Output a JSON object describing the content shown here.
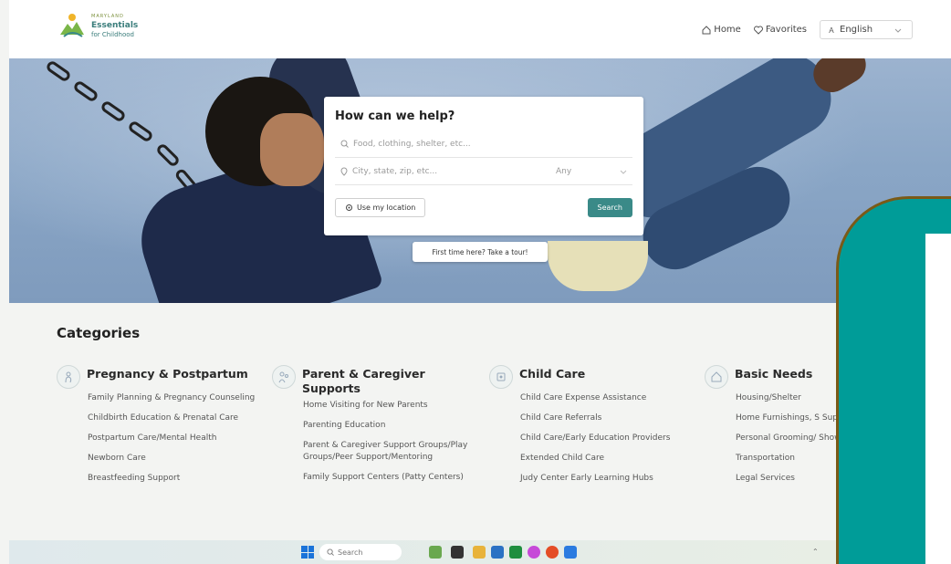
{
  "header": {
    "logo": {
      "line1": "MARYLAND",
      "line2": "Essentials",
      "line3": "for Childhood"
    },
    "nav": {
      "home": "Home",
      "favorites": "Favorites",
      "language": "English"
    }
  },
  "search": {
    "title": "How can we help?",
    "query_placeholder": "Food, clothing, shelter, etc...",
    "location_placeholder": "City, state, zip, etc...",
    "radius_value": "Any",
    "use_location_label": "Use my location",
    "search_label": "Search",
    "tour_label": "First time here? Take a tour!"
  },
  "categories": {
    "title": "Categories",
    "groups": [
      {
        "title": "Pregnancy & Postpartum",
        "links": [
          "Family Planning & Pregnancy Counseling",
          "Childbirth Education & Prenatal Care",
          "Postpartum Care/Mental Health",
          "Newborn Care",
          "Breastfeeding Support"
        ]
      },
      {
        "title": "Parent & Caregiver Supports",
        "links": [
          "Home Visiting for New Parents",
          "Parenting Education",
          "Parent & Caregiver Support Groups/Play Groups/Peer Support/Mentoring",
          "Family Support Centers (Patty Centers)"
        ]
      },
      {
        "title": "Child Care",
        "links": [
          "Child Care Expense Assistance",
          "Child Care Referrals",
          "Child Care/Early Education Providers",
          "Extended Child Care",
          "Judy Center Early Learning Hubs"
        ]
      },
      {
        "title": "Basic Needs",
        "links": [
          "Housing/Shelter",
          "Home Furnishings, S Supplies",
          "Personal Grooming/ Showers/Baths",
          "Transportation",
          "Legal Services"
        ]
      }
    ]
  },
  "taskbar": {
    "search_placeholder": "Search"
  },
  "colors": {
    "accent": "#3a8a88",
    "overlay_teal": "#009c98",
    "overlay_border": "#7a5a17"
  }
}
